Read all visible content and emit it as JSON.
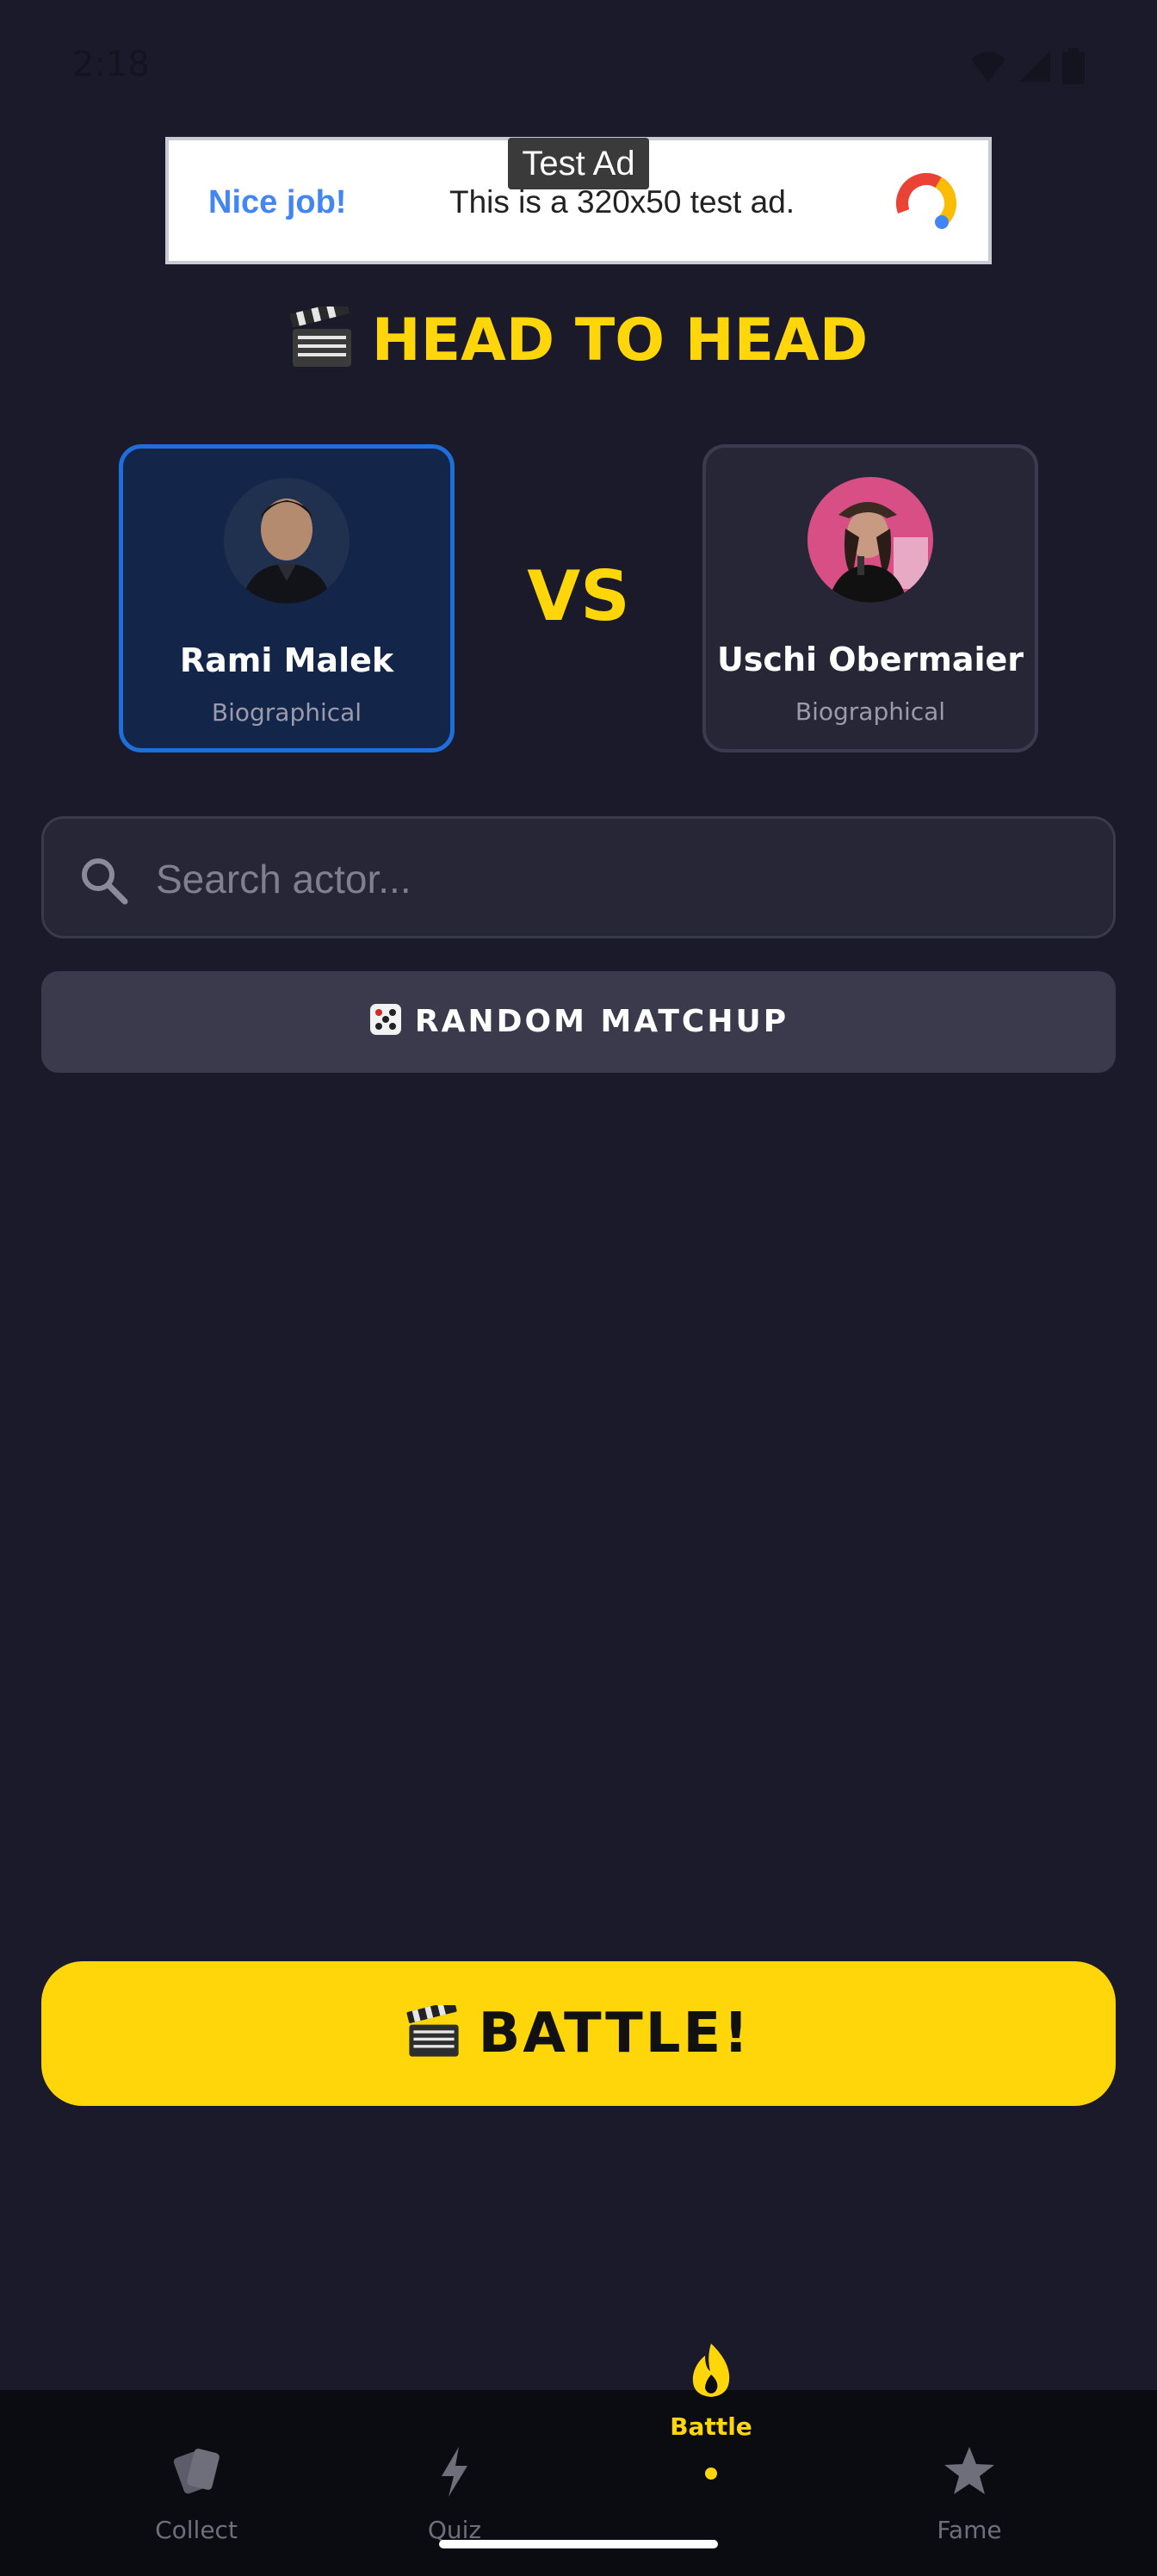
{
  "status_bar": {
    "time": "2:18"
  },
  "ad": {
    "label": "Test Ad",
    "nice": "Nice job!",
    "text": "This is a 320x50 test ad."
  },
  "heading": {
    "title": "HEAD TO HEAD"
  },
  "matchup": {
    "left": {
      "name": "Rami Malek",
      "genre": "Biographical",
      "selected": true
    },
    "vs": "VS",
    "right": {
      "name": "Uschi Obermaier",
      "genre": "Biographical",
      "selected": false
    }
  },
  "search": {
    "placeholder": "Search actor...",
    "value": ""
  },
  "random_button": {
    "label": "RANDOM MATCHUP"
  },
  "battle_button": {
    "label": "BATTLE!"
  },
  "nav": {
    "items": [
      {
        "label": "Collect",
        "icon": "cards-icon",
        "active": false
      },
      {
        "label": "Quiz",
        "icon": "lightning-icon",
        "active": false
      },
      {
        "label": "Battle",
        "icon": "flame-icon",
        "active": true
      },
      {
        "label": "Fame",
        "icon": "star-icon",
        "active": false
      }
    ]
  },
  "colors": {
    "background": "#1a1a2b",
    "accent": "#ffd60a",
    "selected_border": "#1e6fd9",
    "card": "#262637"
  }
}
